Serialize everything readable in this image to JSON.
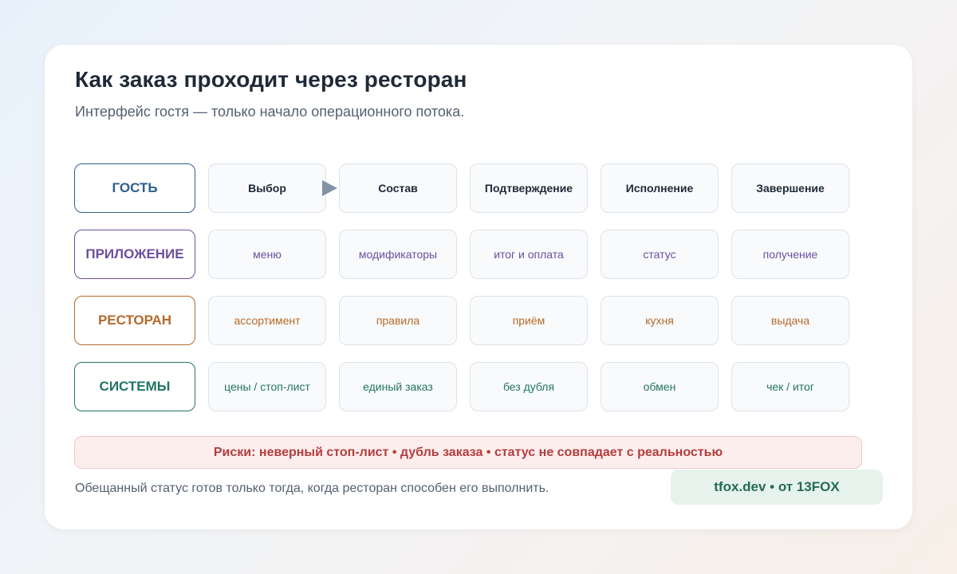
{
  "title": "Как заказ проходит через ресторан",
  "subtitle": "Интерфейс гостя — только начало операционного потока.",
  "colors": {
    "guest": "#2f5f8f",
    "app": "#6b4f9e",
    "restaurant": "#b46a2c",
    "systems": "#237563",
    "risk": "#b43d3d",
    "arrow": "#8392a6"
  },
  "lanes": [
    {
      "label": "ГОСТЬ",
      "cells": [
        "Выбор",
        "Состав",
        "Подтверждение",
        "Исполнение",
        "Завершение"
      ]
    },
    {
      "label": "ПРИЛОЖЕНИЕ",
      "cells": [
        "меню",
        "модификаторы",
        "итог и оплата",
        "статус",
        "получение"
      ]
    },
    {
      "label": "РЕСТОРАН",
      "cells": [
        "ассортимент",
        "правила",
        "приём",
        "кухня",
        "выдача"
      ]
    },
    {
      "label": "СИСТЕМЫ",
      "cells": [
        "цены / стоп-лист",
        "единый заказ",
        "без дубля",
        "обмен",
        "чек / итог"
      ]
    }
  ],
  "risks": "Риски: неверный стоп-лист • дубль заказа • статус не совпадает с реальностью",
  "footnote": "Обещанный статус готов только тогда, когда ресторан способен его выполнить.",
  "badge": "tfox.dev • от 13FOX"
}
